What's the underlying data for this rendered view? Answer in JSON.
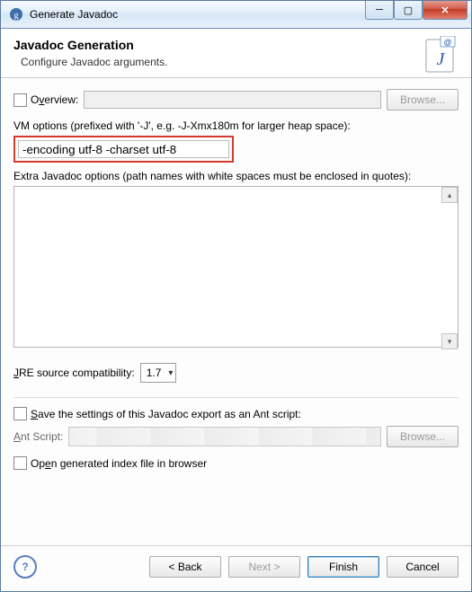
{
  "titlebar": {
    "title": "Generate Javadoc"
  },
  "header": {
    "title": "Javadoc Generation",
    "subtitle": "Configure Javadoc arguments."
  },
  "overview": {
    "label_pre": "O",
    "label_accel": "v",
    "label_post": "erview:",
    "value": "",
    "browse": "Browse..."
  },
  "vm_options": {
    "label": "VM options (prefixed with '-J', e.g. -J-Xmx180m for larger heap space):",
    "value": "-encoding utf-8 -charset utf-8"
  },
  "extra_options": {
    "label": "Extra Javadoc options (path names with white spaces must be enclosed in quotes):",
    "value": ""
  },
  "jre": {
    "label_pre": "",
    "label_accel": "J",
    "label_post": "RE source compatibility:",
    "value": "1.7"
  },
  "save_ant": {
    "label_pre": "",
    "label_accel": "S",
    "label_post": "ave the settings of this Javadoc export as an Ant script:"
  },
  "ant_script": {
    "label_pre": "",
    "label_accel": "A",
    "label_post": "nt Script:",
    "browse": "Browse..."
  },
  "open_index": {
    "label_pre": "Op",
    "label_accel": "e",
    "label_post": "n generated index file in browser"
  },
  "footer": {
    "back": "< Back",
    "next": "Next >",
    "finish": "Finish",
    "cancel": "Cancel"
  }
}
